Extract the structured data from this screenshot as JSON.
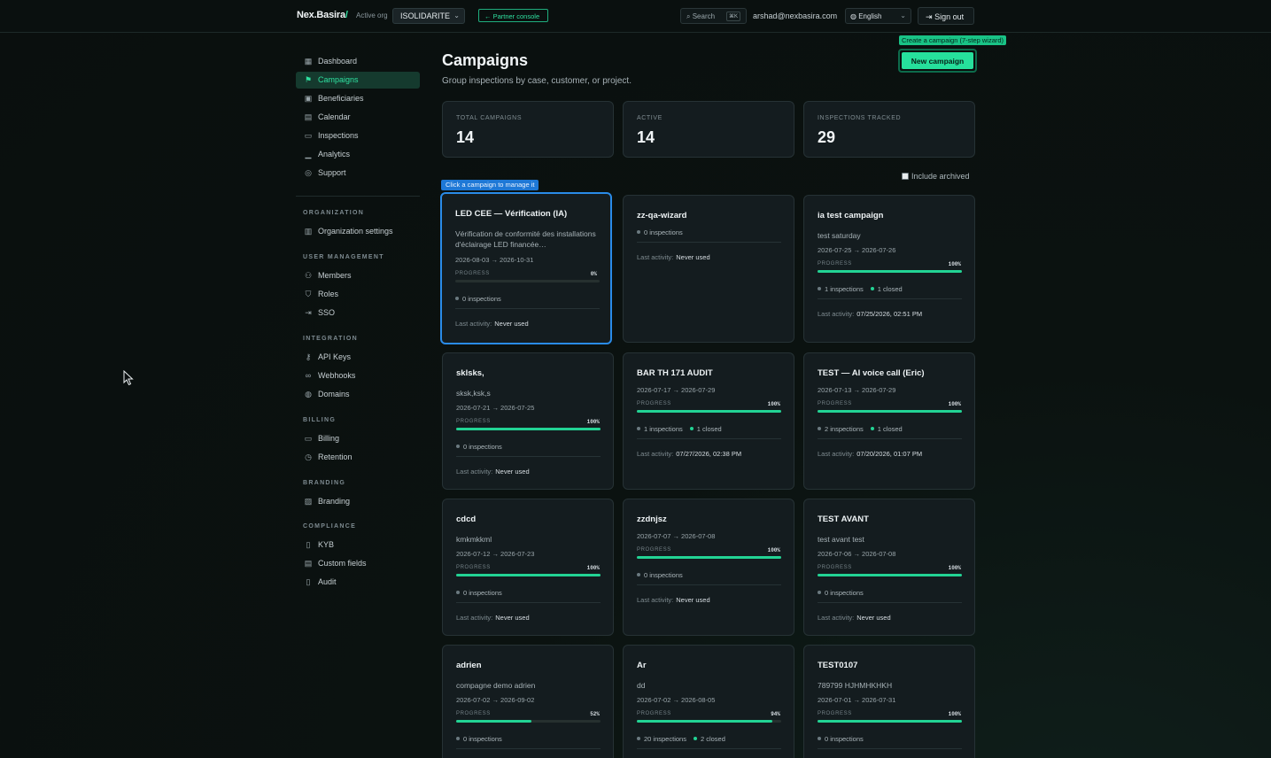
{
  "header": {
    "brand": "Nex.Basira",
    "brand_slash": "/",
    "active_org_label": "Active org",
    "org": "ISOLIDARITE",
    "partner_console": "← Partner console",
    "search": "Search",
    "search_kbd": "⌘K",
    "user_email": "arshad@nexbasira.com",
    "language": "English",
    "sign_out": "Sign out"
  },
  "sidebar": {
    "main_items": [
      {
        "label": "Dashboard",
        "icon": "dashboard-icon"
      },
      {
        "label": "Campaigns",
        "icon": "flag-icon",
        "active": true
      },
      {
        "label": "Beneficiaries",
        "icon": "beneficiaries-icon"
      },
      {
        "label": "Calendar",
        "icon": "calendar-icon"
      },
      {
        "label": "Inspections",
        "icon": "video-icon"
      },
      {
        "label": "Analytics",
        "icon": "chart-icon"
      },
      {
        "label": "Support",
        "icon": "support-icon"
      }
    ],
    "sections": [
      {
        "title": "ORGANIZATION",
        "items": [
          {
            "label": "Organization settings",
            "icon": "building-icon"
          }
        ]
      },
      {
        "title": "USER MANAGEMENT",
        "items": [
          {
            "label": "Members",
            "icon": "users-icon"
          },
          {
            "label": "Roles",
            "icon": "shield-icon"
          },
          {
            "label": "SSO",
            "icon": "login-icon"
          }
        ]
      },
      {
        "title": "INTEGRATION",
        "items": [
          {
            "label": "API Keys",
            "icon": "key-icon"
          },
          {
            "label": "Webhooks",
            "icon": "link-icon"
          },
          {
            "label": "Domains",
            "icon": "globe-icon"
          }
        ]
      },
      {
        "title": "BILLING",
        "items": [
          {
            "label": "Billing",
            "icon": "card-icon"
          },
          {
            "label": "Retention",
            "icon": "clock-icon"
          }
        ]
      },
      {
        "title": "BRANDING",
        "items": [
          {
            "label": "Branding",
            "icon": "image-icon"
          }
        ]
      },
      {
        "title": "COMPLIANCE",
        "items": [
          {
            "label": "KYB",
            "icon": "file-check-icon"
          },
          {
            "label": "Custom fields",
            "icon": "form-icon"
          },
          {
            "label": "Audit",
            "icon": "file-icon"
          }
        ]
      }
    ]
  },
  "main": {
    "title": "Campaigns",
    "subtitle": "Group inspections by case, customer, or project.",
    "new_tooltip": "Create a campaign (7-step wizard)",
    "new_button": "New campaign",
    "stats": [
      {
        "label": "TOTAL CAMPAIGNS",
        "value": "14"
      },
      {
        "label": "ACTIVE",
        "value": "14"
      },
      {
        "label": "INSPECTIONS TRACKED",
        "value": "29"
      }
    ],
    "include_archived": "Include archived",
    "click_tooltip": "Click a campaign to manage it",
    "progress_label": "PROGRESS",
    "last_activity_label": "Last activity:",
    "campaigns": [
      {
        "title": "LED CEE — Vérification (IA)",
        "desc": "Vérification de conformité des installations d'éclairage LED financée…",
        "dates": "2026-08-03 → 2026-10-31",
        "progress": "0%",
        "progress_value": 0,
        "inspections": "0 inspections",
        "closed": "",
        "last": "Never used",
        "selected": true
      },
      {
        "title": "zz-qa-wizard",
        "desc": "",
        "dates": "",
        "progress": "",
        "progress_value": null,
        "inspections": "0 inspections",
        "closed": "",
        "last": "Never used"
      },
      {
        "title": "ia test campaign",
        "desc": "test saturday",
        "dates": "2026-07-25 → 2026-07-26",
        "progress": "100%",
        "progress_value": 100,
        "inspections": "1 inspections",
        "closed": "1 closed",
        "last": "07/25/2026, 02:51 PM"
      },
      {
        "title": "sklsks,",
        "desc": "sksk,ksk,s",
        "dates": "2026-07-21 → 2026-07-25",
        "progress": "100%",
        "progress_value": 100,
        "inspections": "0 inspections",
        "closed": "",
        "last": "Never used"
      },
      {
        "title": "BAR TH 171 AUDIT",
        "desc": "",
        "dates": "2026-07-17 → 2026-07-29",
        "progress": "100%",
        "progress_value": 100,
        "inspections": "1 inspections",
        "closed": "1 closed",
        "last": "07/27/2026, 02:38 PM"
      },
      {
        "title": "TEST — AI voice call (Eric)",
        "desc": "",
        "dates": "2026-07-13 → 2026-07-29",
        "progress": "100%",
        "progress_value": 100,
        "inspections": "2 inspections",
        "closed": "1 closed",
        "last": "07/20/2026, 01:07 PM"
      },
      {
        "title": "cdcd",
        "desc": "kmkmkkml",
        "dates": "2026-07-12 → 2026-07-23",
        "progress": "100%",
        "progress_value": 100,
        "inspections": "0 inspections",
        "closed": "",
        "last": "Never used"
      },
      {
        "title": "zzdnjsz",
        "desc": "",
        "dates": "2026-07-07 → 2026-07-08",
        "progress": "100%",
        "progress_value": 100,
        "inspections": "0 inspections",
        "closed": "",
        "last": "Never used"
      },
      {
        "title": "TEST AVANT",
        "desc": "test avant test",
        "dates": "2026-07-06 → 2026-07-08",
        "progress": "100%",
        "progress_value": 100,
        "inspections": "0 inspections",
        "closed": "",
        "last": "Never used"
      },
      {
        "title": "adrien",
        "desc": "compagne demo adrien",
        "dates": "2026-07-02 → 2026-09-02",
        "progress": "52%",
        "progress_value": 52,
        "inspections": "0 inspections",
        "closed": "",
        "last": ""
      },
      {
        "title": "Ar",
        "desc": "dd",
        "dates": "2026-07-02 → 2026-08-05",
        "progress": "94%",
        "progress_value": 94,
        "inspections": "20 inspections",
        "closed": "2 closed",
        "last": ""
      },
      {
        "title": "TEST0107",
        "desc": "789799 HJHMHKHKH",
        "dates": "2026-07-01 → 2026-07-31",
        "progress": "100%",
        "progress_value": 100,
        "inspections": "0 inspections",
        "closed": "",
        "last": ""
      }
    ]
  },
  "colors": {
    "accent": "#22d394",
    "selected_border": "#2a8be8",
    "tooltip_blue": "#1e78d6"
  }
}
